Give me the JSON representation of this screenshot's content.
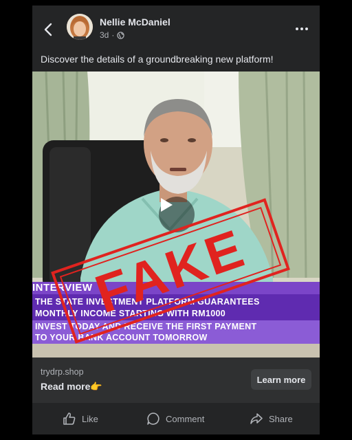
{
  "post": {
    "author": "Nellie McDaniel",
    "time": "3d",
    "separator": "·",
    "caption": "Discover the details of a groundbreaking new platform!"
  },
  "media": {
    "banner_tag": "INTERVIEW",
    "banner_line1": "THE STATE INVESTMENT PLATFORM GUARANTEES",
    "banner_line2": "MONTHLY INCOME STARTING WITH RM1000",
    "banner_line3": "INVEST TODAY AND RECEIVE THE FIRST PAYMENT",
    "banner_line4": "TO YOUR BANK ACCOUNT TOMORROW",
    "stamp_text": "FAKE",
    "stamp_color": "#e0231f",
    "banner_color": "#7b45c8"
  },
  "link": {
    "domain": "trydrp.shop",
    "read_more": "Read more👉",
    "cta": "Learn more"
  },
  "actions": {
    "like": "Like",
    "comment": "Comment",
    "share": "Share"
  },
  "icons": [
    "back-arrow-icon",
    "globe-icon",
    "more-dots-icon",
    "play-icon",
    "like-icon",
    "comment-icon",
    "share-icon"
  ]
}
